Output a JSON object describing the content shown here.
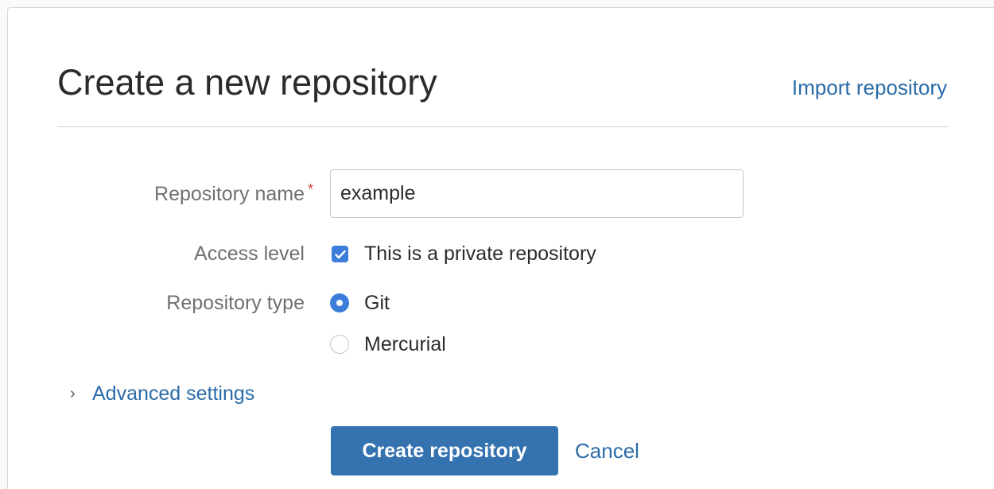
{
  "header": {
    "title": "Create a new repository",
    "import_link": "Import repository"
  },
  "form": {
    "repo_name": {
      "label": "Repository name",
      "required_marker": "*",
      "value": "example"
    },
    "access_level": {
      "label": "Access level",
      "checkbox_label": "This is a private repository",
      "checked": true
    },
    "repo_type": {
      "label": "Repository type",
      "options": [
        {
          "label": "Git",
          "selected": true
        },
        {
          "label": "Mercurial",
          "selected": false
        }
      ]
    },
    "advanced": {
      "label": "Advanced settings",
      "icon": "chevron-right-icon"
    }
  },
  "actions": {
    "create_label": "Create repository",
    "cancel_label": "Cancel"
  },
  "colors": {
    "accent": "#3572b0",
    "link": "#2a6ba8",
    "required": "#d04437"
  }
}
